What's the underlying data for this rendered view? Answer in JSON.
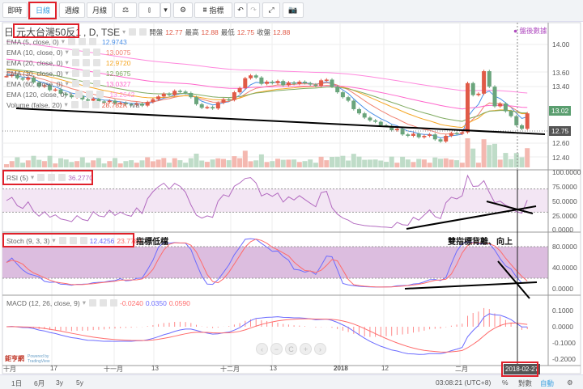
{
  "toolbar": {
    "realtime": "即時",
    "daily": "日線",
    "weekly": "週線",
    "monthly": "月線",
    "indicators": "指標"
  },
  "header": {
    "symbol_icon": "日",
    "symbol": "元大台灣50反1",
    "suffix": ", D, TSE",
    "open_label": "開盤",
    "open": "12.77",
    "high_label": "最高",
    "high": "12.88",
    "low_label": "最低",
    "low": "12.75",
    "close_label": "收盤",
    "close": "12.88",
    "after_hours": "盤後數據"
  },
  "legend": [
    {
      "label": "EMA (5, close, 0)",
      "value": "12.9743",
      "color": "#4a8fe7"
    },
    {
      "label": "EMA (10, close, 0)",
      "value": "13.0075",
      "color": "#f08070"
    },
    {
      "label": "EMA (20, close, 0)",
      "value": "12.9720",
      "color": "#f5a623"
    },
    {
      "label": "EMA (30, close, 0)",
      "value": "12.9675",
      "color": "#7faa60"
    },
    {
      "label": "EMA (60, close, 0)",
      "value": "13.0327",
      "color": "#ff66cc"
    },
    {
      "label": "EMA (120, close, 0)",
      "value": "13.2642",
      "color": "#ff88dd"
    }
  ],
  "volume_legend": {
    "label": "Volume (false, 20)",
    "value": "28.782K",
    "extra": "n/a"
  },
  "rsi_legend": {
    "label": "RSI (5)",
    "value": "36.2770"
  },
  "stoch_legend": {
    "label": "Stoch (9, 3, 3)",
    "k": "12.4256",
    "d": "23.7783"
  },
  "macd_legend": {
    "label": "MACD (12, 26, close, 9)",
    "hist": "-0.0240",
    "macd": "0.0350",
    "signal": "0.0590"
  },
  "annotations": {
    "low_zone": "指標低檔",
    "divergence": "雙指標背離、向上"
  },
  "price_axis": [
    "14.00",
    "13.60",
    "13.40",
    "12.60",
    "12.40"
  ],
  "price_tags": {
    "last": "13.02",
    "cross": "12.75"
  },
  "rsi_axis": [
    "100.0000",
    "75.0000",
    "50.0000",
    "25.0000",
    "0.0000"
  ],
  "stoch_axis": [
    "80.0000",
    "40.0000",
    "0.0000"
  ],
  "macd_axis": [
    "0.1000",
    "0.0000",
    "-0.1000",
    "-0.2000"
  ],
  "time_axis": [
    "十月",
    "17",
    "十一月",
    "13",
    "十二月",
    "13",
    "2018",
    "12",
    "二月"
  ],
  "crosshair_date": "2018-02-27",
  "bottom": {
    "r1d": "1日",
    "r6m": "6月",
    "r3y": "3y",
    "r5y": "5y",
    "time": "03:08:21 (UTC+8)",
    "pct": "%",
    "log": "對數",
    "auto": "自動"
  },
  "logo": {
    "name": "鉅亨網",
    "powered": "Powered by TradingView"
  },
  "colors": {
    "up": "#e05a47",
    "down": "#6aa57c",
    "rsi": "#b36bc0",
    "k": "#6b6bff",
    "d": "#ff6b6b"
  },
  "chart_data": {
    "type": "candlestick",
    "closes": [
      13.55,
      13.57,
      13.52,
      13.5,
      13.53,
      13.46,
      13.4,
      13.42,
      13.35,
      13.36,
      13.3,
      13.28,
      13.25,
      13.27,
      13.22,
      13.2,
      13.23,
      13.19,
      13.18,
      13.2,
      13.16,
      13.17,
      13.15,
      13.14,
      13.16,
      13.13,
      13.18,
      13.22,
      13.26,
      13.3,
      13.28,
      13.34,
      13.33,
      13.31,
      13.25,
      13.15,
      13.1,
      13.11,
      13.09,
      13.17,
      13.22,
      13.21,
      13.32,
      13.38,
      13.52,
      13.56,
      13.53,
      13.44,
      13.47,
      13.45,
      13.48,
      13.42,
      13.46,
      13.44,
      13.47,
      13.45,
      13.43,
      13.41,
      13.49,
      13.5,
      13.4,
      13.32,
      13.25,
      13.2,
      13.08,
      13.02,
      12.96,
      12.92,
      12.9,
      12.85,
      12.84,
      12.78,
      12.8,
      12.72,
      12.7,
      12.73,
      12.68,
      12.7,
      12.72,
      12.65,
      12.62,
      12.7,
      12.74,
      12.73,
      12.75,
      13.45,
      13.28,
      13.3,
      13.62,
      13.4,
      13.12,
      13.16,
      13.05,
      12.98,
      12.85,
      12.8,
      13.02
    ],
    "ema_periods": [
      5,
      10,
      20,
      30,
      60,
      120
    ],
    "ema_seeds": [
      13.58,
      13.62,
      13.65,
      13.66,
      13.8,
      14.05
    ],
    "price_range": [
      12.4,
      14.0
    ]
  }
}
